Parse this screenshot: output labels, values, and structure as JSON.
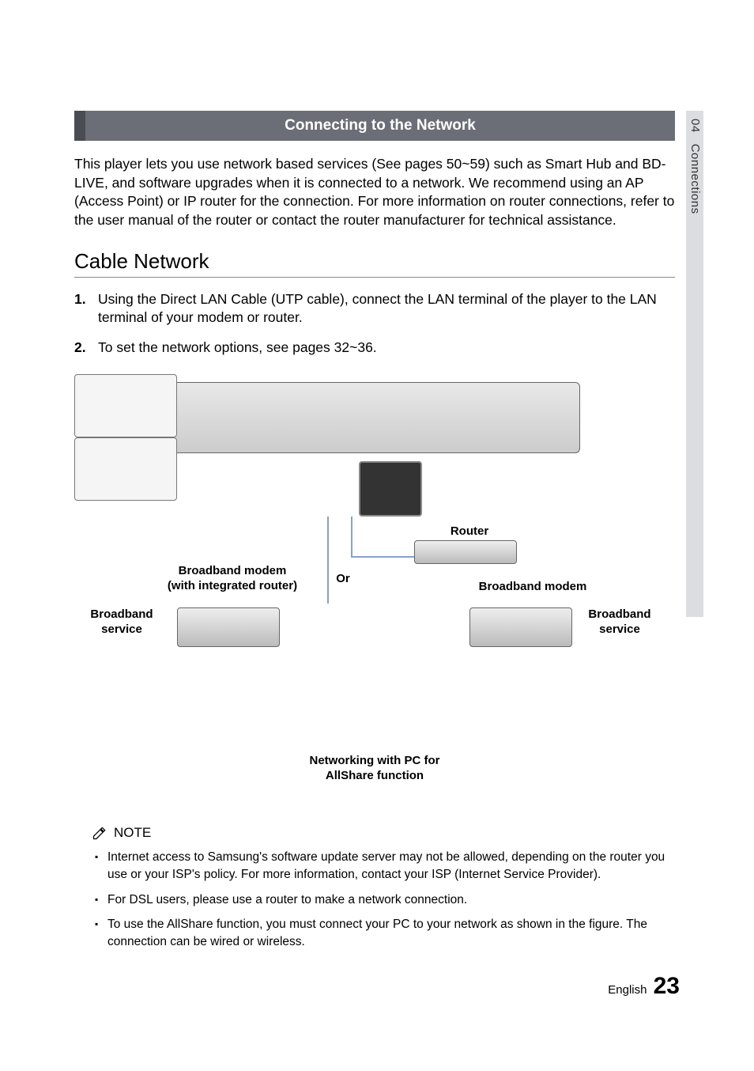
{
  "side": {
    "chapter_num": "04",
    "chapter_title": "Connections"
  },
  "banner": "Connecting to the Network",
  "intro": "This player lets you use network based services (See pages 50~59) such as Smart Hub and BD-LIVE, and software upgrades when it is connected to a network. We recommend using an AP (Access Point) or IP router for the connection. For more information on router connections, refer to the user manual of the router or contact the router manufacturer for technical assistance.",
  "subhead": "Cable Network",
  "steps": [
    "Using the Direct LAN Cable (UTP cable), connect the LAN terminal of the player to the LAN terminal of your modem or router.",
    "To set the network options, see pages 32~36."
  ],
  "diagram": {
    "or": "Or",
    "router": "Router",
    "broadband_modem_integrated": "Broadband modem\n(with integrated router)",
    "broadband_modem": "Broadband modem",
    "broadband_service_left": "Broadband\nservice",
    "broadband_service_right": "Broadband\nservice",
    "caption": "Networking with PC for\nAllShare function"
  },
  "note": {
    "heading": "NOTE",
    "items": [
      "Internet access to Samsung's software update server may not be allowed, depending on the router you use or your ISP's policy. For more information, contact your ISP (Internet Service Provider).",
      "For DSL users, please use a router to make a network connection.",
      "To use the AllShare function, you must connect your PC to your network as shown in the figure. The connection can be wired or wireless."
    ]
  },
  "footer": {
    "lang": "English",
    "page": "23"
  }
}
